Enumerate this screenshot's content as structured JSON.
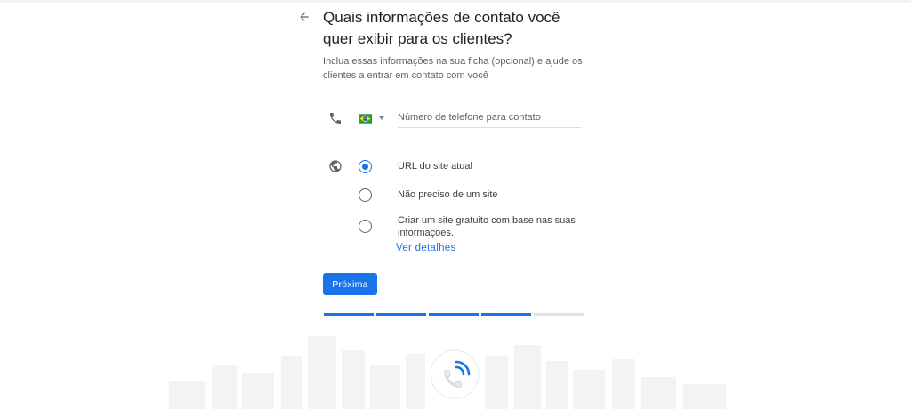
{
  "header": {
    "back_icon": "arrow-back-icon",
    "title": "Quais informações de contato você quer exibir para os clientes?",
    "subtitle": "Inclua essas informações na sua ficha (opcional) e ajude os clientes a entrar em contato com você"
  },
  "phone": {
    "icon": "phone-icon",
    "country_flag": "brazil-flag-icon",
    "placeholder": "Número de telefone para contato",
    "value": ""
  },
  "website": {
    "icon": "globe-icon",
    "options": [
      {
        "label": "URL do site atual",
        "selected": true
      },
      {
        "label": "Não preciso de um site",
        "selected": false
      },
      {
        "label": "Criar um site gratuito com base nas suas informações.",
        "selected": false
      }
    ],
    "details_link": "Ver detalhes"
  },
  "next_button": "Próxima",
  "progress": {
    "total_steps": 5,
    "completed_steps": 4
  },
  "colors": {
    "accent": "#1a73e8",
    "text_primary": "#202124",
    "text_secondary": "#5f6368",
    "divider": "#dadce0",
    "progress_empty": "#e0e0e0"
  }
}
